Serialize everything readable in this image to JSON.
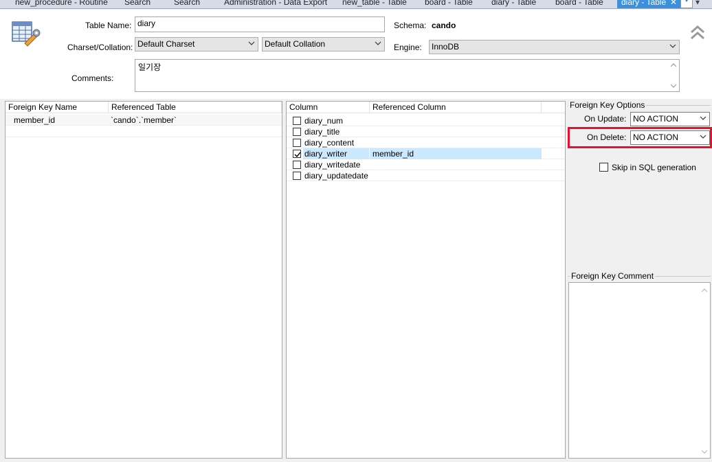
{
  "tabs": [
    {
      "label": "new_procedure - Routine",
      "active": false
    },
    {
      "label": "Search",
      "active": false
    },
    {
      "label": "Search",
      "active": false
    },
    {
      "label": "Administration - Data Export",
      "active": false
    },
    {
      "label": "new_table - Table",
      "active": false
    },
    {
      "label": "board - Table",
      "active": false
    },
    {
      "label": "diary - Table",
      "active": false
    },
    {
      "label": "board - Table",
      "active": false
    },
    {
      "label": "diary - Table",
      "active": true
    }
  ],
  "tab_close_glyph": "✕",
  "tab_overflow_glyph": "▾",
  "header": {
    "table_name_label": "Table Name:",
    "table_name_value": "diary",
    "schema_label": "Schema:",
    "schema_value": "cando",
    "charset_label": "Charset/Collation:",
    "charset_value": "Default Charset",
    "collation_value": "Default Collation",
    "engine_label": "Engine:",
    "engine_value": "InnoDB",
    "comments_label": "Comments:",
    "comments_value": "일기장"
  },
  "fk_list": {
    "columns": [
      "Foreign Key Name",
      "Referenced Table"
    ],
    "rows": [
      {
        "name": "member_id",
        "table": "`cando`.`member`"
      }
    ]
  },
  "column_map": {
    "columns": [
      "Column",
      "Referenced Column"
    ],
    "rows": [
      {
        "column": "diary_num",
        "checked": false,
        "ref": ""
      },
      {
        "column": "diary_title",
        "checked": false,
        "ref": ""
      },
      {
        "column": "diary_content",
        "checked": false,
        "ref": ""
      },
      {
        "column": "diary_writer",
        "checked": true,
        "ref": "member_id"
      },
      {
        "column": "diary_writedate",
        "checked": false,
        "ref": ""
      },
      {
        "column": "diary_updatedate",
        "checked": false,
        "ref": ""
      }
    ]
  },
  "fk_options": {
    "title": "Foreign Key Options",
    "on_update_label": "On Update:",
    "on_update_value": "NO ACTION",
    "on_delete_label": "On Delete:",
    "on_delete_value": "NO ACTION",
    "skip_sql_label": "Skip in SQL generation",
    "skip_sql_checked": false
  },
  "fk_comment": {
    "title": "Foreign Key Comment",
    "value": ""
  },
  "colors": {
    "active_tab": "#3c8fdc",
    "highlight_box": "#e8112d",
    "selection": "#cce8ff"
  }
}
